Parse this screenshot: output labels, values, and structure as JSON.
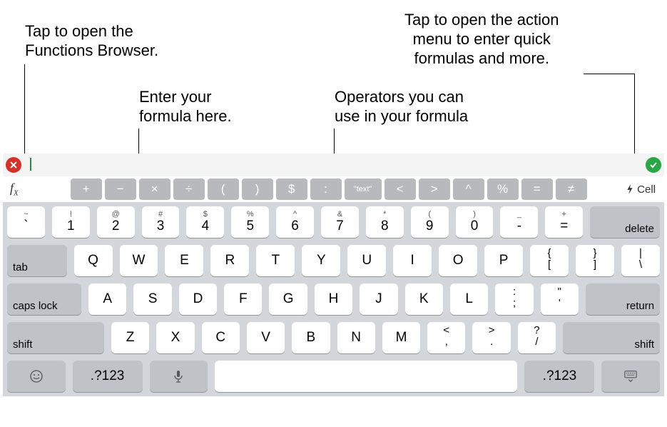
{
  "callouts": {
    "functions_browser": "Tap to open the\nFunctions Browser.",
    "enter_formula": "Enter your\nformula here.",
    "operators": "Operators you can\nuse in your formula",
    "action_menu": "Tap to open the action\nmenu to enter quick\nformulas and more."
  },
  "formula_bar": {
    "value": ""
  },
  "toolbar": {
    "fx_label": "f",
    "fx_sub": "X",
    "cell_label": "Cell"
  },
  "operators": [
    "+",
    "−",
    "×",
    "÷",
    "(",
    ")",
    "$",
    ":",
    "\"text\"",
    "<",
    ">",
    "^",
    "%",
    "=",
    "≠"
  ],
  "keyboard": {
    "row1": [
      {
        "upper": "~",
        "main": "`"
      },
      {
        "upper": "!",
        "main": "1"
      },
      {
        "upper": "@",
        "main": "2"
      },
      {
        "upper": "#",
        "main": "3"
      },
      {
        "upper": "$",
        "main": "4"
      },
      {
        "upper": "%",
        "main": "5"
      },
      {
        "upper": "^",
        "main": "6"
      },
      {
        "upper": "&",
        "main": "7"
      },
      {
        "upper": "*",
        "main": "8"
      },
      {
        "upper": "(",
        "main": "9"
      },
      {
        "upper": ")",
        "main": "0"
      },
      {
        "upper": "_",
        "main": "-"
      },
      {
        "upper": "+",
        "main": "="
      }
    ],
    "delete": "delete",
    "tab": "tab",
    "row2": [
      "Q",
      "W",
      "E",
      "R",
      "T",
      "Y",
      "U",
      "I",
      "O",
      "P"
    ],
    "row2_end": [
      {
        "upper": "{",
        "main": "["
      },
      {
        "upper": "}",
        "main": "]"
      },
      {
        "upper": "|",
        "main": "\\"
      }
    ],
    "caps": "caps lock",
    "row3": [
      "A",
      "S",
      "D",
      "F",
      "G",
      "H",
      "J",
      "K",
      "L"
    ],
    "row3_end": [
      {
        "upper": ":",
        "main": ";"
      },
      {
        "upper": "\"",
        "main": "'"
      }
    ],
    "return": "return",
    "shift": "shift",
    "row4": [
      "Z",
      "X",
      "C",
      "V",
      "B",
      "N",
      "M"
    ],
    "row4_end": [
      {
        "upper": "<",
        "main": ","
      },
      {
        "upper": ">",
        "main": "."
      },
      {
        "upper": "?",
        "main": "/"
      }
    ],
    "numswitch": ".?123"
  }
}
